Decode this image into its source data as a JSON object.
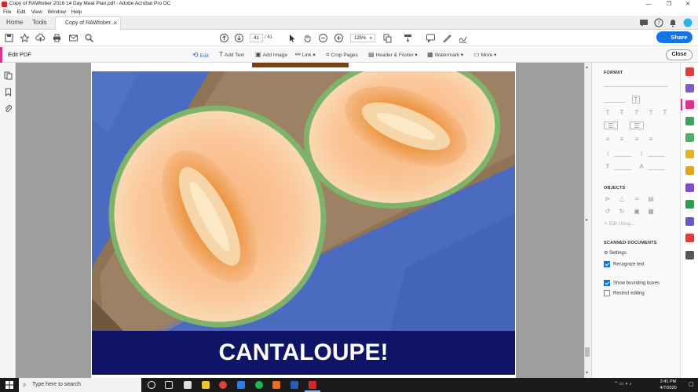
{
  "window": {
    "title": "Copy of RAWtober 2016 14 Day Meal Plan.pdf - Adobe Acrobat Pro DC",
    "controls": [
      "—",
      "❐",
      "✕"
    ]
  },
  "menu": [
    "File",
    "Edit",
    "View",
    "Window",
    "Help"
  ],
  "tabs": {
    "home": "Home",
    "tools": "Tools",
    "document": "Copy of RAWtober...",
    "close": "×"
  },
  "toolbar": {
    "page_current": "41",
    "page_total": "/ 41",
    "zoom": "125%",
    "share_label": "Share"
  },
  "edit_toolbar": {
    "label": "Edit PDF",
    "tools": [
      {
        "label": "Edit",
        "active": true
      },
      {
        "label": "Add Text"
      },
      {
        "label": "Add Image"
      },
      {
        "label": "Link ▾"
      },
      {
        "label": "Crop Pages"
      },
      {
        "label": "Header & Footer ▾"
      },
      {
        "label": "Watermark ▾"
      },
      {
        "label": "More ▾"
      }
    ],
    "close_label": "Close"
  },
  "document": {
    "banner_text": "CANTALOUPE!"
  },
  "right_panel": {
    "format_heading": "FORMAT",
    "objects_heading": "OBJECTS",
    "edit_using": "Edit Using...",
    "scanned_heading": "SCANNED DOCUMENTS",
    "settings_label": "Settings",
    "recognize_text": {
      "label": "Recognize text",
      "checked": true
    },
    "show_bounding": {
      "label": "Show bounding boxes",
      "checked": true
    },
    "restrict_editing": {
      "label": "Restrict editing",
      "checked": false
    }
  },
  "taskbar": {
    "search_placeholder": "Type here to search",
    "time": "2:41 PM",
    "date": "4/7/2020"
  },
  "colors": {
    "accent": "#1473e6",
    "edit_pink": "#d7338a",
    "banner": "#0f1466"
  }
}
